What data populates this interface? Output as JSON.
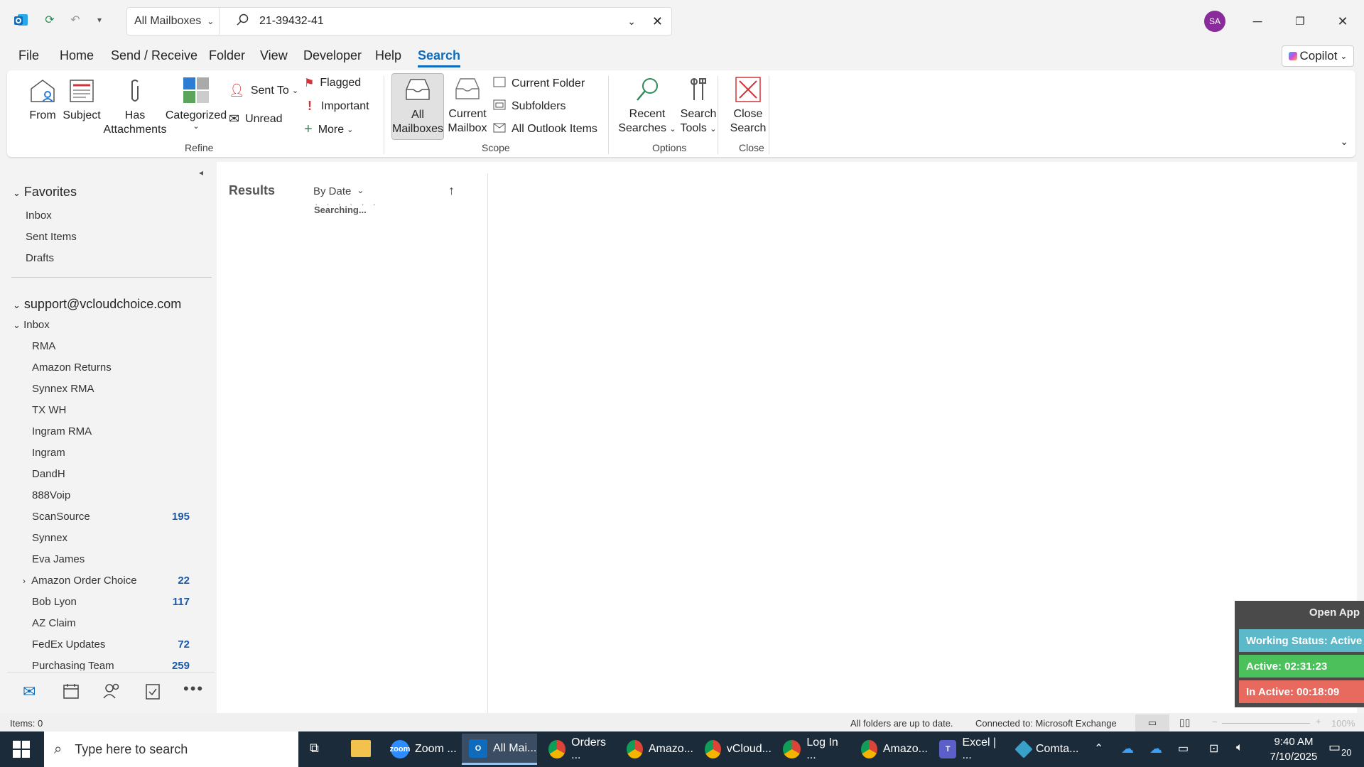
{
  "window": {
    "scope_dropdown": "All Mailboxes",
    "search_query": "21-39432-41",
    "avatar_initials": "SA"
  },
  "menu": {
    "items": [
      "File",
      "Home",
      "Send / Receive",
      "Folder",
      "View",
      "Developer",
      "Help",
      "Search"
    ],
    "active": "Search",
    "copilot_label": "Copilot"
  },
  "ribbon": {
    "refine": {
      "from": "From",
      "subject": "Subject",
      "has_attachments_1": "Has",
      "has_attachments_2": "Attachments",
      "categorized": "Categorized",
      "sent_to": "Sent To",
      "unread": "Unread",
      "flagged": "Flagged",
      "important": "Important",
      "more": "More",
      "label": "Refine"
    },
    "scope": {
      "all_mailboxes_1": "All",
      "all_mailboxes_2": "Mailboxes",
      "current_mailbox_1": "Current",
      "current_mailbox_2": "Mailbox",
      "current_folder": "Current Folder",
      "subfolders": "Subfolders",
      "all_outlook_items": "All Outlook Items",
      "label": "Scope"
    },
    "options": {
      "recent_searches_1": "Recent",
      "recent_searches_2": "Searches",
      "search_tools_1": "Search",
      "search_tools_2": "Tools",
      "label": "Options"
    },
    "close": {
      "close_search_1": "Close",
      "close_search_2": "Search",
      "label": "Close"
    }
  },
  "folders": {
    "favorites_header": "Favorites",
    "favorites": [
      "Inbox",
      "Sent Items",
      "Drafts"
    ],
    "account": "support@vcloudchoice.com",
    "inbox": "Inbox",
    "subfolders": [
      {
        "name": "RMA",
        "count": ""
      },
      {
        "name": "Amazon Returns",
        "count": ""
      },
      {
        "name": "Synnex RMA",
        "count": ""
      },
      {
        "name": "TX WH",
        "count": ""
      },
      {
        "name": "Ingram RMA",
        "count": ""
      },
      {
        "name": "Ingram",
        "count": ""
      },
      {
        "name": "DandH",
        "count": ""
      },
      {
        "name": "888Voip",
        "count": ""
      },
      {
        "name": "ScanSource",
        "count": "195"
      },
      {
        "name": "Synnex",
        "count": ""
      },
      {
        "name": "Eva James",
        "count": ""
      },
      {
        "name": "Amazon Order Choice",
        "count": "22"
      },
      {
        "name": "Bob Lyon",
        "count": "117"
      },
      {
        "name": "AZ Claim",
        "count": ""
      },
      {
        "name": "FedEx Updates",
        "count": "72"
      },
      {
        "name": "Purchasing Team",
        "count": "259"
      }
    ]
  },
  "results": {
    "title": "Results",
    "sort": "By Date",
    "status": "Searching..."
  },
  "statusbar": {
    "items": "Items: 0",
    "sync": "All folders are up to date.",
    "connection": "Connected to: Microsoft Exchange",
    "zoom": "100%"
  },
  "widget": {
    "open_app": "Open App",
    "working_status": "Working Status: Active",
    "active": "Active: 02:31:23",
    "inactive": "In Active: 00:18:09"
  },
  "taskbar": {
    "search_placeholder": "Type here to search",
    "apps": [
      "Zoom ...",
      "All Mai...",
      "Orders ...",
      "Amazo...",
      "vCloud...",
      "Log In ...",
      "Amazo...",
      "Excel | ...",
      "Comta..."
    ],
    "time": "9:40 AM",
    "date": "7/10/2025",
    "notifications": "20"
  },
  "colors": {
    "accent": "#0f6cbd",
    "avatar": "#8a2b9b",
    "taskbar": "#1c2b3a",
    "working_status": "#5bb9c9",
    "active": "#4cc05a",
    "inactive": "#e86a5f"
  }
}
